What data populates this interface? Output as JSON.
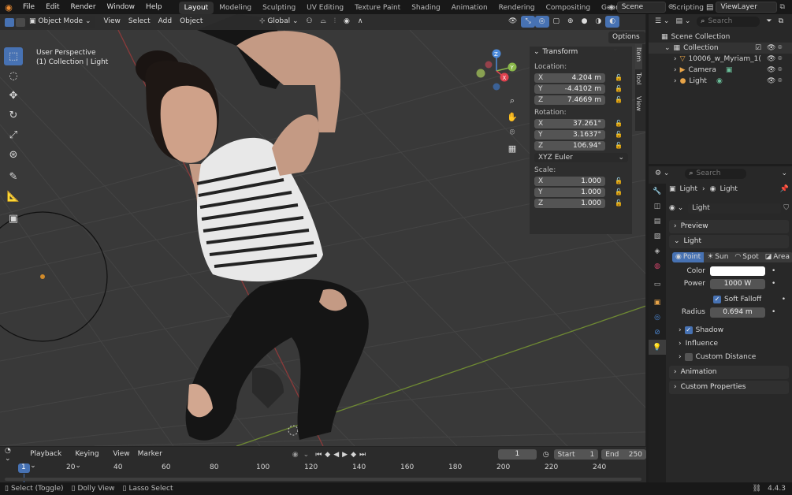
{
  "menubar": {
    "menus": [
      "File",
      "Edit",
      "Render",
      "Window",
      "Help"
    ],
    "workspaces": [
      "Layout",
      "Modeling",
      "Sculpting",
      "UV Editing",
      "Texture Paint",
      "Shading",
      "Animation",
      "Rendering",
      "Compositing",
      "Geometry Nodes",
      "Scripting"
    ],
    "add_tab": "+",
    "scene": "Scene",
    "view_layer": "ViewLayer"
  },
  "viewport": {
    "mode": "Object Mode",
    "menus": [
      "View",
      "Select",
      "Add",
      "Object"
    ],
    "transform_orientation": "Global",
    "overlay_title": "User Perspective",
    "overlay_collection": "(1) Collection | Light",
    "options": "Options",
    "gizmo": {
      "x": "X",
      "y": "Y",
      "z": "Z"
    }
  },
  "npanel": {
    "tabs": [
      "Item",
      "Tool",
      "View"
    ],
    "transform_header": "Transform",
    "location_label": "Location:",
    "location": [
      {
        "axis": "X",
        "value": "4.204 m"
      },
      {
        "axis": "Y",
        "value": "-4.4102 m"
      },
      {
        "axis": "Z",
        "value": "7.4669 m"
      }
    ],
    "rotation_label": "Rotation:",
    "rotation": [
      {
        "axis": "X",
        "value": "37.261°"
      },
      {
        "axis": "Y",
        "value": "3.1637°"
      },
      {
        "axis": "Z",
        "value": "106.94°"
      }
    ],
    "rotation_mode": "XYZ Euler",
    "scale_label": "Scale:",
    "scale": [
      {
        "axis": "X",
        "value": "1.000"
      },
      {
        "axis": "Y",
        "value": "1.000"
      },
      {
        "axis": "Z",
        "value": "1.000"
      }
    ]
  },
  "timeline": {
    "menus": [
      "Playback",
      "Keying",
      "View",
      "Marker"
    ],
    "current_frame": "1",
    "start_label": "Start",
    "start": "1",
    "end_label": "End",
    "end": "250",
    "ticks": [
      "1",
      "20",
      "40",
      "60",
      "80",
      "100",
      "120",
      "140",
      "160",
      "180",
      "200",
      "220",
      "240"
    ]
  },
  "statusbar": {
    "items": [
      "Select (Toggle)",
      "Dolly View",
      "Lasso Select"
    ],
    "version": "4.4.3"
  },
  "outliner": {
    "search_placeholder": "Search",
    "rows": [
      {
        "label": "Scene Collection",
        "indent": 0
      },
      {
        "label": "Collection",
        "indent": 1
      },
      {
        "label": "10006_w_Myriam_1(",
        "indent": 2
      },
      {
        "label": "Camera",
        "indent": 2
      },
      {
        "label": "Light",
        "indent": 2
      }
    ]
  },
  "properties": {
    "search_placeholder": "Search",
    "breadcrumb": [
      "Light",
      "Light"
    ],
    "datablock": "Light",
    "panels": {
      "preview": "Preview",
      "light": "Light",
      "light_types": [
        "Point",
        "Sun",
        "Spot",
        "Area"
      ],
      "color_label": "Color",
      "color_value": "#ffffff",
      "power_label": "Power",
      "power": "1000 W",
      "soft_falloff": "Soft Falloff",
      "radius_label": "Radius",
      "radius": "0.694 m",
      "shadow": "Shadow",
      "influence": "Influence",
      "custom_distance": "Custom Distance",
      "animation": "Animation",
      "custom_properties": "Custom Properties"
    }
  },
  "colors": {
    "accent": "#4772b3",
    "axis_x": "#e0424f",
    "axis_y": "#8ab84a",
    "axis_z": "#4d8bdb"
  }
}
